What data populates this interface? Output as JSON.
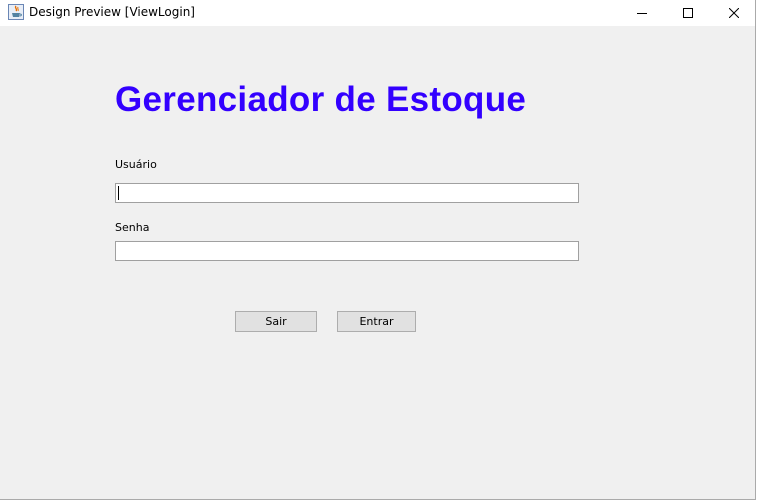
{
  "window": {
    "title": "Design Preview [ViewLogin]",
    "controls": [
      "minimize-icon",
      "maximize-icon",
      "close-icon"
    ]
  },
  "login": {
    "heading": "Gerenciador de Estoque",
    "username_label": "Usuário",
    "username_value": "",
    "password_label": "Senha",
    "password_value": "",
    "exit_button": "Sair",
    "enter_button": "Entrar"
  },
  "colors": {
    "heading": "#3300ff",
    "background": "#f0f0f0",
    "button_face": "#e1e1e1"
  }
}
